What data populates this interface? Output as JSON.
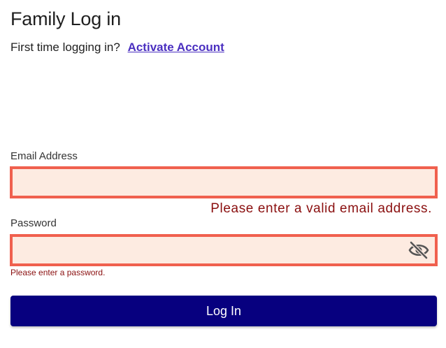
{
  "header": {
    "title": "Family Log in"
  },
  "activation": {
    "prompt": "First time logging in?",
    "link_label": "Activate Account"
  },
  "form": {
    "email": {
      "label": "Email Address",
      "value": "",
      "error": "Please enter a valid email address."
    },
    "password": {
      "label": "Password",
      "value": "",
      "error": "Please enter a password.",
      "toggle_icon": "eye-slash-icon"
    },
    "submit_label": "Log In"
  },
  "colors": {
    "error_border": "#f0604e",
    "error_fill": "#fdebe1",
    "error_text": "#8a0f0f",
    "link": "#4a2fc0",
    "button": "#07007f"
  }
}
